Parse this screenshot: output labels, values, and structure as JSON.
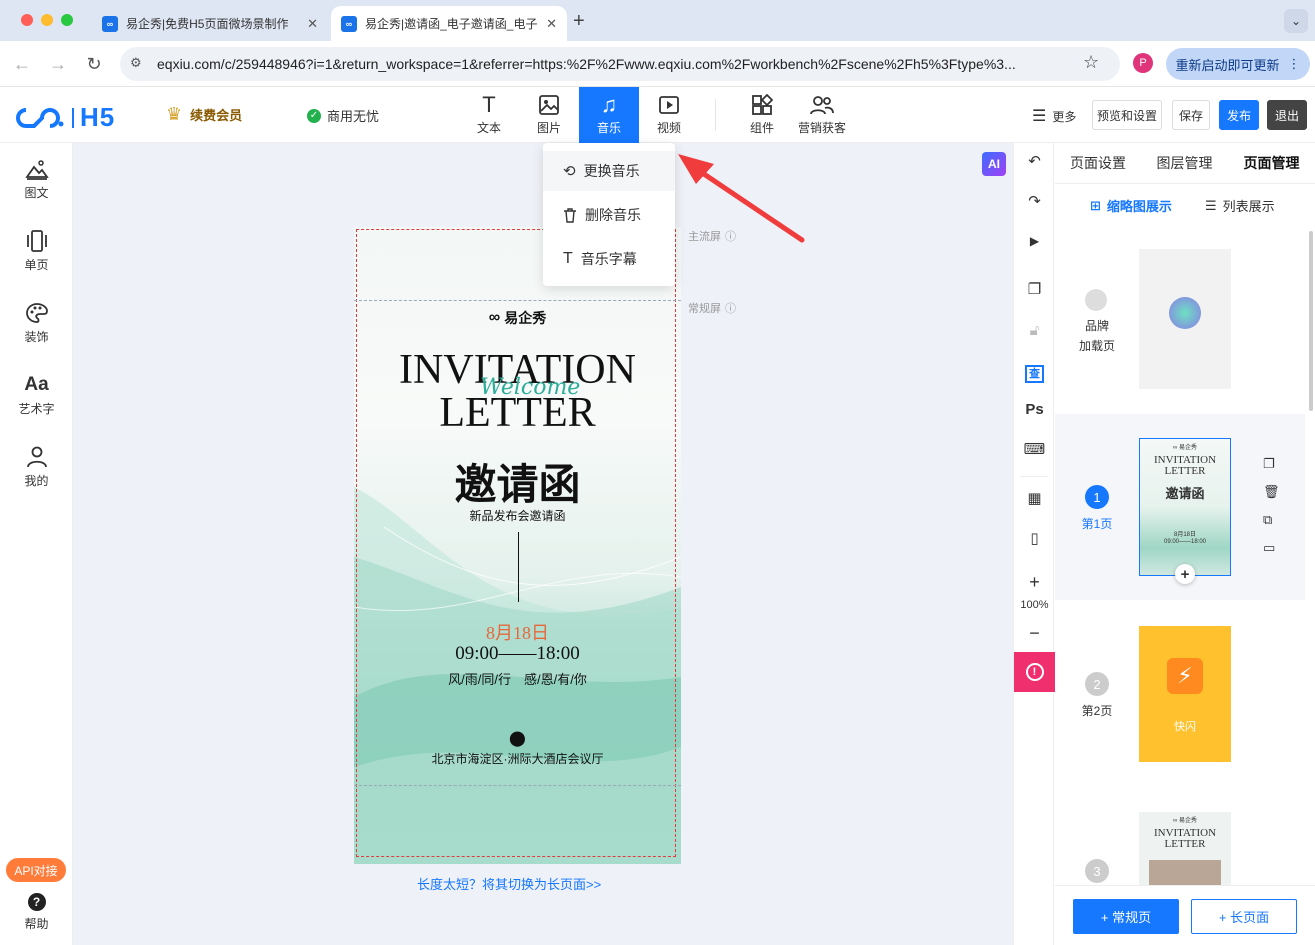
{
  "browser": {
    "tabs": [
      {
        "title": "易企秀|免费H5页面微场景制作"
      },
      {
        "title": "易企秀|邀请函_电子邀请函_电子"
      }
    ],
    "url": "eqxiu.com/c/259448946?i=1&return_workspace=1&referrer=https:%2F%2Fwww.eqxiu.com%2Fworkbench%2Fscene%2Fh5%3Ftype%3...",
    "profile_initial": "P",
    "update_label": "重新启动即可更新"
  },
  "header": {
    "logo_text": "H5",
    "vip_label": "续费会员",
    "commercial_label": "商用无忧",
    "tools": [
      {
        "label": "文本",
        "icon": "text-icon"
      },
      {
        "label": "图片",
        "icon": "image-icon"
      },
      {
        "label": "音乐",
        "icon": "music-icon"
      },
      {
        "label": "视频",
        "icon": "video-icon"
      },
      {
        "label": "组件",
        "icon": "component-icon"
      },
      {
        "label": "营销获客",
        "icon": "users-icon"
      }
    ],
    "more_label": "更多",
    "preview_label": "预览和设置",
    "save_label": "保存",
    "publish_label": "发布",
    "exit_label": "退出"
  },
  "music_menu": {
    "items": [
      {
        "label": "更换音乐",
        "icon": "refresh-icon"
      },
      {
        "label": "删除音乐",
        "icon": "trash-icon"
      },
      {
        "label": "音乐字幕",
        "icon": "text-icon"
      }
    ]
  },
  "left_nav": [
    {
      "label": "图文"
    },
    {
      "label": "单页"
    },
    {
      "label": "装饰"
    },
    {
      "label": "艺术字"
    },
    {
      "label": "我的"
    }
  ],
  "api_label": "API对接",
  "help_label": "帮助",
  "canvas": {
    "main_screen_label": "主流屏",
    "normal_screen_label": "常规屏",
    "switch_link": "长度太短？将其切换为长页面>>",
    "ai_badge": "AI"
  },
  "invitation": {
    "brand": "易企秀",
    "title_line1": "INVITATION",
    "title_line2": "LETTER",
    "script_word": "Welcome",
    "chinese_title": "邀请函",
    "subtitle": "新品发布会邀请函",
    "date": "8月18日",
    "time": "09:00——18:00",
    "motto": "风/雨/同/行　感/恩/有/你",
    "address": "北京市海淀区·洲际大酒店会议厅"
  },
  "right_tools": {
    "zoom": "100%",
    "ps_label": "Ps",
    "ocr_label": "查"
  },
  "right_panel": {
    "tabs": [
      "页面设置",
      "图层管理",
      "页面管理"
    ],
    "view_thumb_label": "缩略图展示",
    "view_list_label": "列表展示",
    "brand_page_line1": "品牌",
    "brand_page_line2": "加载页",
    "pages": [
      {
        "number": "1",
        "label": "第1页"
      },
      {
        "number": "2",
        "label": "第2页",
        "thumb_text": "快闪"
      },
      {
        "number": "3",
        "label": ""
      }
    ],
    "add_normal_label": "+ 常规页",
    "add_long_label": "+ 长页面"
  }
}
